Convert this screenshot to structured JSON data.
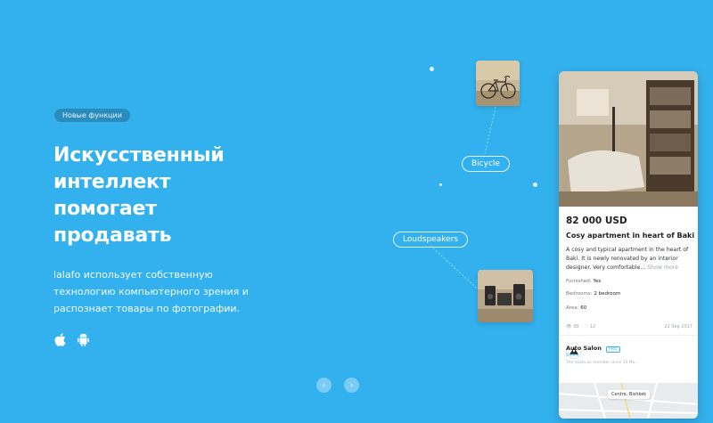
{
  "hero": {
    "badge": "Новые функции",
    "headline": [
      "Искусственный",
      "интеллект",
      "помогает",
      "продавать"
    ],
    "description": [
      "lalafo использует собственную",
      "технологию компьютерного зрения и",
      "распознает товары по фотографии."
    ],
    "stores": [
      "apple-icon",
      "android-icon"
    ]
  },
  "tags": {
    "bicycle": "Bicycle",
    "loudspeakers": "Loudspeakers"
  },
  "listing": {
    "price": "82 000 USD",
    "title": "Cosy apartment in heart of Baki",
    "description": "A cosy and typical apartment in the heart of Baki. It is newly renovated by an interior designer. Very comfortable...",
    "show_more": "Show more",
    "attributes": [
      {
        "label": "Furnished:",
        "value": "Yes"
      },
      {
        "label": "Bedrooms:",
        "value": "2 bedroom"
      },
      {
        "label": "Area:",
        "value": "60"
      }
    ],
    "views": "38",
    "favorites": "12",
    "date": "22 Sep 2017",
    "seller": {
      "name": "Auto Salon",
      "badge": "PRO",
      "status": "Online",
      "since": "The lalafo.az member since 10 Mo..."
    },
    "map_label": "Centre, Bishkek"
  },
  "colors": {
    "background": "#33b1ee",
    "accent": "#33b1ee"
  }
}
